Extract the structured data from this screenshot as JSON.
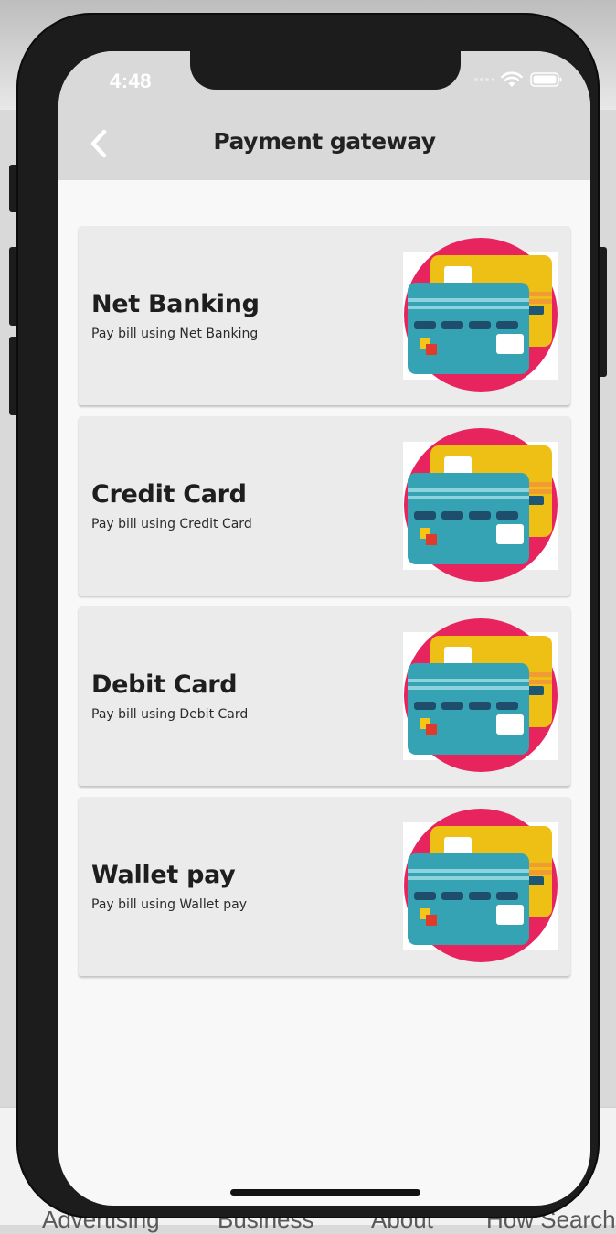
{
  "status": {
    "time": "4:48"
  },
  "header": {
    "title": "Payment gateway"
  },
  "options": [
    {
      "title": "Net Banking",
      "subtitle": "Pay bill using Net Banking"
    },
    {
      "title": "Credit Card",
      "subtitle": "Pay bill using Credit Card"
    },
    {
      "title": "Debit Card",
      "subtitle": "Pay bill using Debit Card"
    },
    {
      "title": "Wallet pay",
      "subtitle": "Pay bill using Wallet pay"
    }
  ],
  "background_footer": {
    "links": [
      "Advertising",
      "Business",
      "About",
      "How Search"
    ]
  },
  "colors": {
    "header_bg": "#d9d9d9",
    "card_bg": "#ebebeb",
    "accent_pink": "#e8245e",
    "card_teal": "#36a3b4",
    "card_yellow": "#eebf15"
  }
}
